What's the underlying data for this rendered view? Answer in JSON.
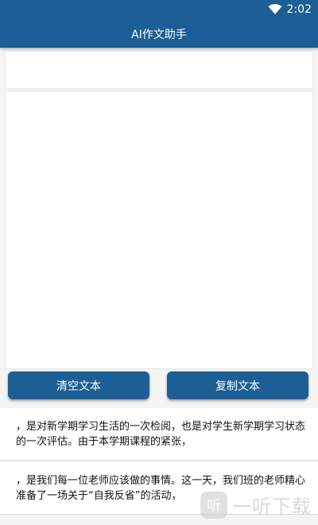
{
  "status_bar": {
    "time": "2:02",
    "wifi_icon": "wifi-icon"
  },
  "app_bar": {
    "title": "AI作文助手"
  },
  "input_top": {
    "value": "",
    "placeholder": ""
  },
  "input_main": {
    "value": "",
    "placeholder": ""
  },
  "buttons": {
    "clear_label": "清空文本",
    "copy_label": "复制文本"
  },
  "results": [
    {
      "text": "，是对新学期学习生活的一次检阅，也是对学生新学期学习状态的一次评估。由于本学期课程的紧张，"
    },
    {
      "text": "，是我们每一位老师应该做的事情。这一天，我们班的老师精心准备了一场关于“自我反省”的活动，"
    }
  ],
  "watermark": {
    "logo_char": "听",
    "text": "一听下载"
  },
  "colors": {
    "primary": "#1c5f96",
    "background": "#f4f4f4"
  }
}
